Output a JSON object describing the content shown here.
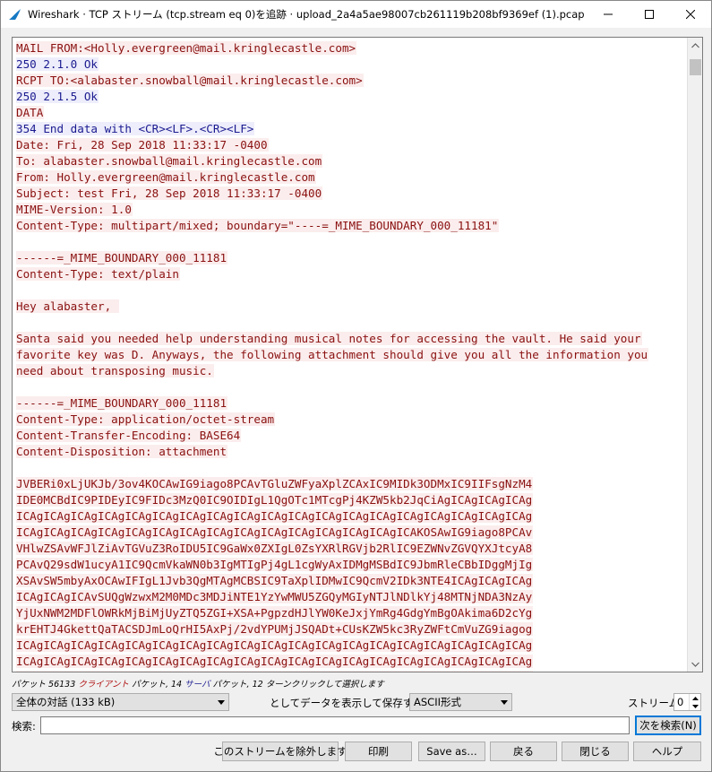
{
  "window": {
    "title": "Wireshark · TCP ストリーム (tcp.stream eq 0)を追跡 · upload_2a4a5ae98007cb261119b208bf9369ef (1).pcap"
  },
  "stream_lines": [
    {
      "dir": "client",
      "text": "MAIL FROM:<Holly.evergreen@mail.kringlecastle.com>"
    },
    {
      "dir": "server",
      "text": "250 2.1.0 Ok"
    },
    {
      "dir": "client",
      "text": "RCPT TO:<alabaster.snowball@mail.kringlecastle.com>"
    },
    {
      "dir": "server",
      "text": "250 2.1.5 Ok"
    },
    {
      "dir": "client",
      "text": "DATA"
    },
    {
      "dir": "server",
      "text": "354 End data with <CR><LF>.<CR><LF>"
    },
    {
      "dir": "client",
      "text": "Date: Fri, 28 Sep 2018 11:33:17 -0400"
    },
    {
      "dir": "client",
      "text": "To: alabaster.snowball@mail.kringlecastle.com"
    },
    {
      "dir": "client",
      "text": "From: Holly.evergreen@mail.kringlecastle.com"
    },
    {
      "dir": "client",
      "text": "Subject: test Fri, 28 Sep 2018 11:33:17 -0400"
    },
    {
      "dir": "client",
      "text": "MIME-Version: 1.0"
    },
    {
      "dir": "client",
      "text": "Content-Type: multipart/mixed; boundary=\"----=_MIME_BOUNDARY_000_11181\""
    },
    {
      "dir": "client",
      "text": ""
    },
    {
      "dir": "client",
      "text": "------=_MIME_BOUNDARY_000_11181"
    },
    {
      "dir": "client",
      "text": "Content-Type: text/plain"
    },
    {
      "dir": "client",
      "text": ""
    },
    {
      "dir": "client",
      "text": "Hey alabaster, "
    },
    {
      "dir": "client",
      "text": ""
    },
    {
      "dir": "client",
      "text": "Santa said you needed help understanding musical notes for accessing the vault. He said your"
    },
    {
      "dir": "client",
      "text": "favorite key was D. Anyways, the following attachment should give you all the information you"
    },
    {
      "dir": "client",
      "text": "need about transposing music."
    },
    {
      "dir": "client",
      "text": ""
    },
    {
      "dir": "client",
      "text": "------=_MIME_BOUNDARY_000_11181"
    },
    {
      "dir": "client",
      "text": "Content-Type: application/octet-stream"
    },
    {
      "dir": "client",
      "text": "Content-Transfer-Encoding: BASE64"
    },
    {
      "dir": "client",
      "text": "Content-Disposition: attachment"
    },
    {
      "dir": "client",
      "text": ""
    },
    {
      "dir": "client",
      "text": "JVBERi0xLjUKJb/3ov4KOCAwIG9iago8PCAvTGluZWFyaXplZCAxIC9MIDk3ODMxIC9IIFsgNzM4"
    },
    {
      "dir": "client",
      "text": "IDE0MCBdIC9PIDEyIC9FIDc3MzQ0IC9OIDIgL1QgOTc1MTcgPj4KZW5kb2JqCiAgICAgICAgICAg"
    },
    {
      "dir": "client",
      "text": "ICAgICAgICAgICAgICAgICAgICAgICAgICAgICAgICAgICAgICAgICAgICAgICAgICAgICAgICAg"
    },
    {
      "dir": "client",
      "text": "ICAgICAgICAgICAgICAgICAgICAgICAgICAgICAgICAgICAgICAgICAgICAKOSAwIG9iago8PCAv"
    },
    {
      "dir": "client",
      "text": "VHlwZSAvWFJlZiAvTGVuZ3RoIDU5IC9GaWx0ZXIgL0ZsYXRlRGVjb2RlIC9EZWNvZGVQYXJtcyA8"
    },
    {
      "dir": "client",
      "text": "PCAvQ29sdW1ucyA1IC9QcmVkaWN0b3IgMTIgPj4gL1cgWyAxIDMgMSBdIC9JbmRleCBbIDggMjIg"
    },
    {
      "dir": "client",
      "text": "XSAvSW5mbyAxOCAwIFIgL1Jvb3QgMTAgMCBSIC9TaXplIDMwIC9QcmV2IDk3NTE4ICAgICAgICAg"
    },
    {
      "dir": "client",
      "text": "ICAgICAgICAvSUQgWzwxM2M0MDc3MDJiNTE1YzYwMWU5ZGQyMGIyNTJlNDlkYj48MTNjNDA3NzAy"
    },
    {
      "dir": "client",
      "text": "YjUxNWM2MDFlOWRkMjBiMjUyZTQ5ZGI+XSA+PgpzdHJlYW0KeJxjYmRg4GdgYmBgOAkima6D2cYg"
    },
    {
      "dir": "client",
      "text": "krEHTJ4GkettQaTACSDJmLoQrHI5AxPj/2vdYPUMjJSQADt+CUsKZW5kc3RyZWFtCmVuZG9iagog"
    },
    {
      "dir": "client",
      "text": "ICAgICAgICAgICAgICAgICAgICAgICAgICAgICAgICAgICAgICAgICAgICAgICAgICAgICAgICAg"
    },
    {
      "dir": "client",
      "text": "ICAgICAgICAgICAgICAgICAgICAgICAgICAgICAgICAgICAgICAgICAgICAgICAgICAgICAgICAg"
    },
    {
      "dir": "client",
      "text": "ICAgICAgICAgICAgICAgICAgICAgICAgICAgICAgICAgICAgICAgICAgICAgICAgICAgICAgICAg"
    }
  ],
  "status": {
    "prefix": "パケット 56133",
    "client": "クライアント",
    "mid1": "パケット, 14",
    "server": "サーバ",
    "suffix": "パケット, 12 ターンクリックして選択します"
  },
  "controls": {
    "conversation_select": "全体の対話 (133 kB)",
    "show_save_label": "としてデータを表示して保存する",
    "format_select": "ASCII形式",
    "stream_label": "ストリーム",
    "stream_value": "0",
    "search_label": "検索:",
    "search_value": "",
    "find_next_button": "次を検索(N)"
  },
  "buttons": {
    "filter_out": "このストリームを除外します",
    "print": "印刷",
    "save_as": "Save as…",
    "back": "戻る",
    "close": "閉じる",
    "help": "ヘルプ"
  },
  "colors": {
    "client_text": "#8a1010",
    "client_bg": "#fbeded",
    "server_text": "#1a1a90",
    "server_bg": "#ededfb"
  }
}
